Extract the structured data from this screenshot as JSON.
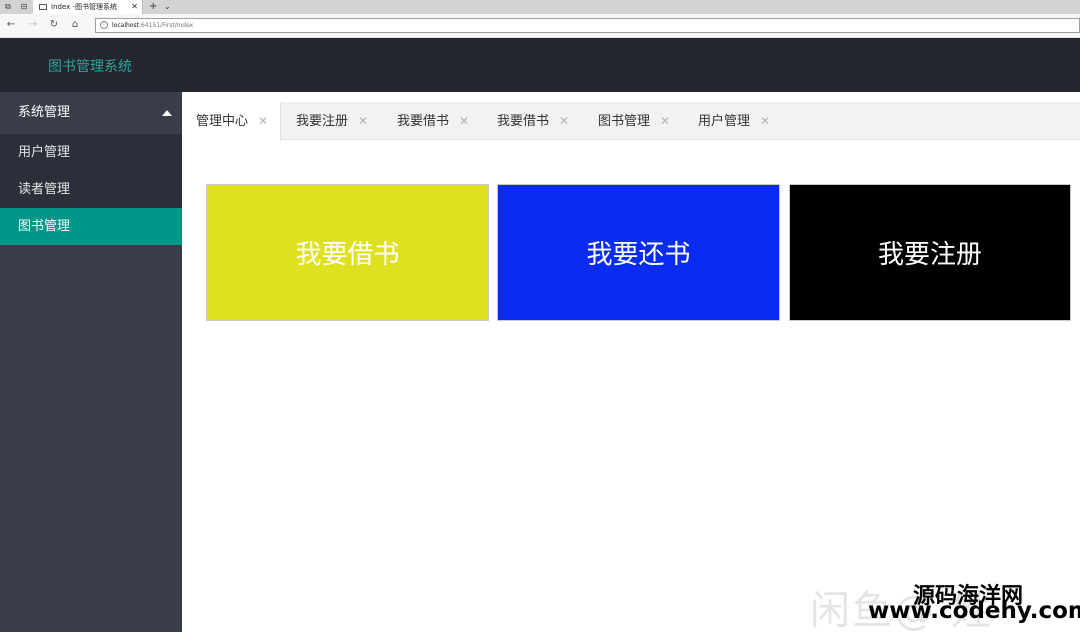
{
  "browser": {
    "tab_title": "Index -图书管理系统",
    "url_host": "localhost",
    "url_rest": ":64151/First/Index"
  },
  "app": {
    "title": "图书管理系统"
  },
  "sidebar": {
    "group_label": "系统管理",
    "items": [
      {
        "label": "用户管理",
        "active": false
      },
      {
        "label": "读者管理",
        "active": false
      },
      {
        "label": "图书管理",
        "active": true
      }
    ]
  },
  "tabs": [
    {
      "label": "管理中心",
      "active": true
    },
    {
      "label": "我要注册",
      "active": false
    },
    {
      "label": "我要借书",
      "active": false
    },
    {
      "label": "我要借书",
      "active": false
    },
    {
      "label": "图书管理",
      "active": false
    },
    {
      "label": "用户管理",
      "active": false
    }
  ],
  "tiles": [
    {
      "label": "我要借书",
      "color": "#dfe01e"
    },
    {
      "label": "我要还书",
      "color": "#0a2bf0"
    },
    {
      "label": "我要注册",
      "color": "#000000"
    }
  ],
  "watermark": {
    "faint": "闲鱼@    姓",
    "site_name": "源码海洋网",
    "site_url": "www.codehy.com"
  },
  "colors": {
    "accent": "#009688",
    "header": "#23262e",
    "sidebar": "#393d49",
    "title": "#2ea59a"
  }
}
